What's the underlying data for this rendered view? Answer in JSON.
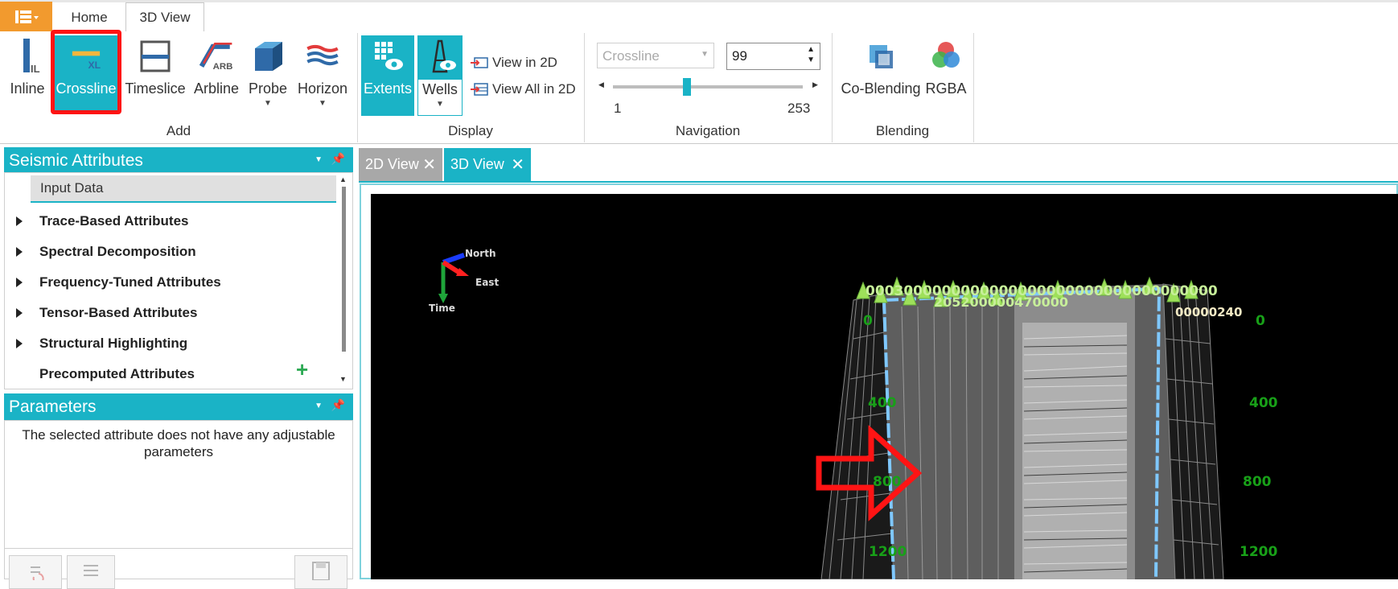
{
  "ribbon_tabs": {
    "home": "Home",
    "view3d": "3D View"
  },
  "add_group": {
    "label": "Add",
    "inline": "Inline",
    "crossline": "Crossline",
    "timeslice": "Timeslice",
    "arbline": "Arbline",
    "probe": "Probe",
    "horizon": "Horizon",
    "inline_icon_text": "IL",
    "crossline_icon_text": "XL",
    "arbline_icon_text": "ARB"
  },
  "display_group": {
    "label": "Display",
    "extents": "Extents",
    "wells": "Wells",
    "view_in_2d": "View in 2D",
    "view_all_in_2d": "View All in 2D"
  },
  "navigation_group": {
    "label": "Navigation",
    "select_value": "Crossline",
    "number_value": "99",
    "slider_min": "1",
    "slider_max": "253",
    "slider_position": 0.39
  },
  "blending_group": {
    "label": "Blending",
    "co_blending": "Co-Blending",
    "rgba": "RGBA"
  },
  "seismic_panel": {
    "title": "Seismic Attributes",
    "input_data": "Input Data",
    "items": [
      "Trace-Based Attributes",
      "Spectral Decomposition",
      "Frequency-Tuned Attributes",
      "Tensor-Based Attributes",
      "Structural Highlighting",
      "Precomputed Attributes"
    ],
    "add_symbol": "+"
  },
  "parameters_panel": {
    "title": "Parameters",
    "message": "The selected attribute does not have any adjustable parameters"
  },
  "view_tabs": {
    "tab_2d": "2D View",
    "tab_3d": "3D View"
  },
  "viewport": {
    "axes": {
      "north": "North",
      "east": "East",
      "time": "Time"
    },
    "depth_left": [
      "0",
      "400",
      "800",
      "1200"
    ],
    "depth_right": [
      "0",
      "400",
      "800",
      "1200"
    ],
    "well_labels_top": "0003000000000000000000000000000000000",
    "well_labels_mid": "205200000470000",
    "well_labels_right": "00000240"
  },
  "colors": {
    "accent": "#1ab3c6",
    "app_menu": "#f29a2e",
    "highlight": "#ff1414",
    "depth_label": "#18a018",
    "well_marker": "#9ee05a",
    "grid_outline": "#7fc8ff"
  }
}
